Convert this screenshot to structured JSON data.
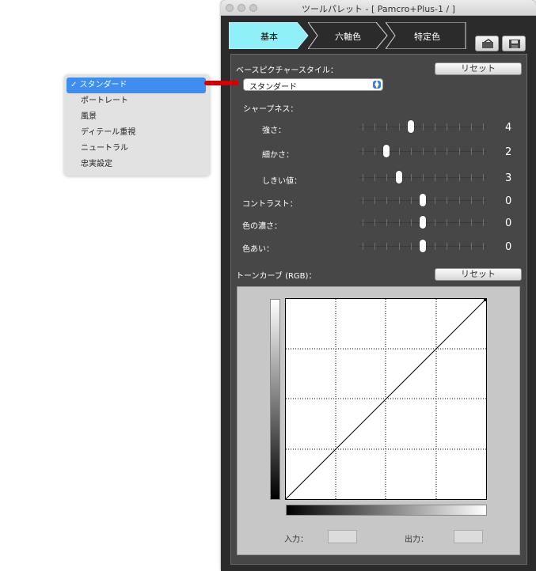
{
  "window": {
    "title": "ツールパレット - [ Pamcro+Plus-1 / ]"
  },
  "tabs": [
    {
      "label": "基本",
      "active": true
    },
    {
      "label": "六軸色",
      "active": false
    },
    {
      "label": "特定色",
      "active": false
    }
  ],
  "header_icons": [
    "open-file-icon",
    "save-icon"
  ],
  "picture_style": {
    "label": "ベースピクチャースタイル：",
    "reset_label": "リセット",
    "selected": "スタンダード"
  },
  "sharpness": {
    "label": "シャープネス：",
    "strength": {
      "label": "強さ：",
      "value": "4"
    },
    "fineness": {
      "label": "細かさ：",
      "value": "2"
    },
    "threshold": {
      "label": "しきい値：",
      "value": "3"
    }
  },
  "contrast": {
    "label": "コントラスト：",
    "value": "0"
  },
  "saturation": {
    "label": "色の濃さ：",
    "value": "0"
  },
  "color_tone": {
    "label": "色あい：",
    "value": "0"
  },
  "tone_curve": {
    "label": "トーンカーブ (RGB)：",
    "reset_label": "リセット",
    "input_label": "入力：",
    "output_label": "出力："
  },
  "dropdown_menu": {
    "items": [
      {
        "label": "✓ スタンダード",
        "selected": true
      },
      {
        "label": "ポートレート",
        "selected": false
      },
      {
        "label": "風景",
        "selected": false
      },
      {
        "label": "ディテール重視",
        "selected": false
      },
      {
        "label": "ニュートラル",
        "selected": false
      },
      {
        "label": "忠実設定",
        "selected": false
      }
    ]
  },
  "colors": {
    "active_tab": "#8ff0f8",
    "menu_highlight": "#3d8ef0",
    "connector": "#d40000",
    "panel_bg": "#474747"
  }
}
